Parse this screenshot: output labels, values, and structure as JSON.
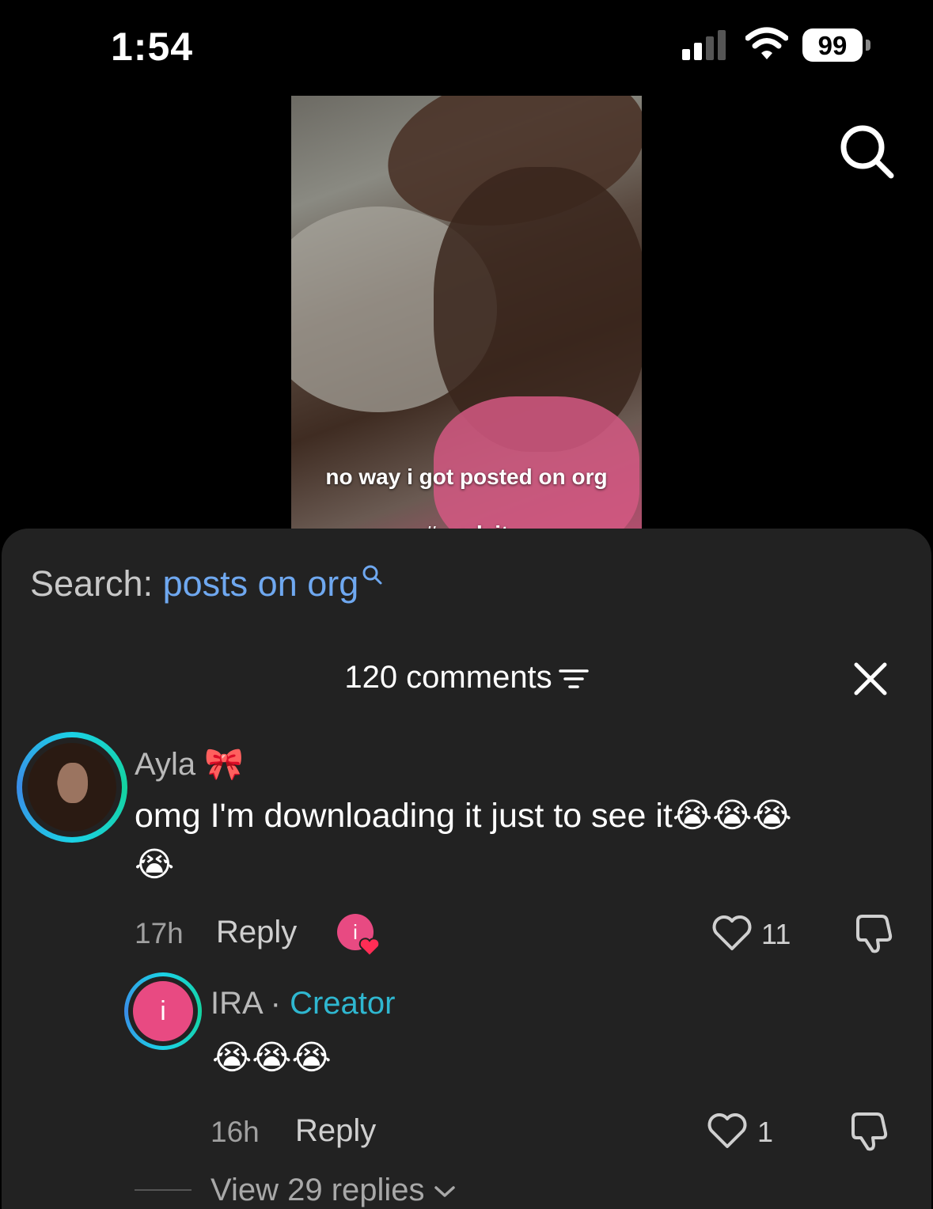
{
  "status_bar": {
    "time": "1:54",
    "battery": "99"
  },
  "video": {
    "caption_line1": "no way i got posted on org",
    "caption_line2": "#madeit"
  },
  "search": {
    "label": "Search:",
    "query": "posts on org"
  },
  "comments": {
    "header": "120 comments",
    "items": [
      {
        "author": "Ayla",
        "author_emoji": "🎀",
        "text": "omg I'm downloading it just to see it😭😭😭",
        "text_line2": "😭",
        "time": "17h",
        "reply_label": "Reply",
        "likes": "11",
        "creator_avatar_letter": "i"
      },
      {
        "author": "IRA",
        "separator": "·",
        "badge": "Creator",
        "avatar_letter": "i",
        "text": "😭😭😭",
        "time": "16h",
        "reply_label": "Reply",
        "likes": "1",
        "view_replies": "View 29 replies"
      }
    ]
  },
  "colors": {
    "sheet_bg": "#222222",
    "link_blue": "#6fa8f0",
    "creator_teal": "#2fb7d0",
    "creator_pink": "#e84a82"
  },
  "icons": [
    "signal-icon",
    "wifi-icon",
    "battery-icon",
    "search-icon",
    "filter-icon",
    "close-icon",
    "heart-icon",
    "dislike-icon",
    "chevron-down-icon"
  ]
}
